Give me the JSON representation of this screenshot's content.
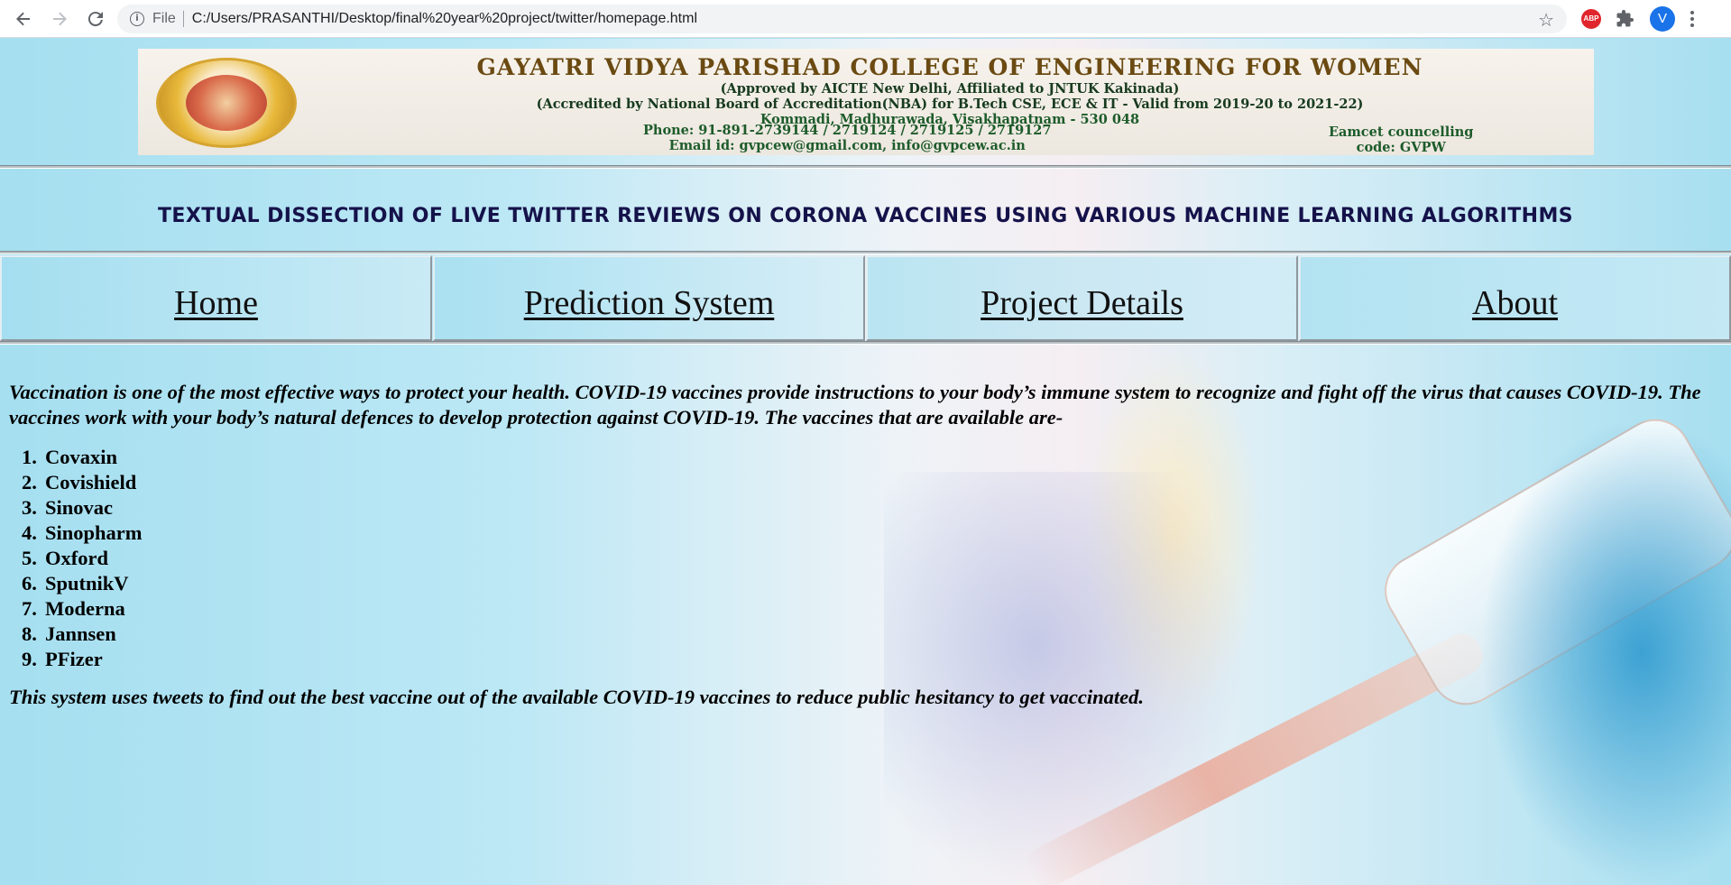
{
  "browser": {
    "file_label": "File",
    "url": "C:/Users/PRASANTHI/Desktop/final%20year%20project/twitter/homepage.html",
    "abp_label": "ABP",
    "profile_initial": "V"
  },
  "banner": {
    "title": "GAYATRI VIDYA PARISHAD COLLEGE OF ENGINEERING FOR WOMEN",
    "approval": "(Approved by AICTE New Delhi, Affiliated to JNTUK Kakinada)",
    "accreditation": "(Accredited by National Board of Accreditation(NBA) for B.Tech CSE, ECE & IT - Valid from 2019-20 to 2021-22)",
    "address": "Kommadi, Madhurawada, Visakhapatnam - 530 048",
    "phone": "Phone: 91-891-2739144 / 2719124 / 2719125 / 2719127",
    "email": "Email id: gvpcew@gmail.com, info@gvpcew.ac.in",
    "eamcet_line1": "Eamcet councelling",
    "eamcet_line2": "code: GVPW"
  },
  "project_title": "TEXTUAL DISSECTION OF LIVE TWITTER REVIEWS ON CORONA VACCINES USING VARIOUS MACHINE LEARNING ALGORITHMS",
  "nav": {
    "items": [
      {
        "label": "Home"
      },
      {
        "label": "Prediction System"
      },
      {
        "label": "Project Details"
      },
      {
        "label": "About"
      }
    ]
  },
  "content": {
    "intro": "Vaccination is one of the most effective ways to protect your health. COVID-19 vaccines provide instructions to your body’s immune system to recognize and fight off the virus that causes COVID-19. The vaccines work with your body’s natural defences to develop protection against COVID-19. The vaccines that are available are-",
    "vaccines": [
      {
        "num": "1.",
        "name": "Covaxin"
      },
      {
        "num": "2.",
        "name": "Covishield"
      },
      {
        "num": "3.",
        "name": "Sinovac"
      },
      {
        "num": "4.",
        "name": "Sinopharm"
      },
      {
        "num": "5.",
        "name": "Oxford"
      },
      {
        "num": "6.",
        "name": "SputnikV"
      },
      {
        "num": "7.",
        "name": "Moderna"
      },
      {
        "num": "8.",
        "name": "Jannsen"
      },
      {
        "num": "9.",
        "name": "PFizer"
      }
    ],
    "outro": "This system uses tweets to find out the best vaccine out of the available COVID-19 vaccines to reduce public hesitancy to get vaccinated."
  },
  "icons": {
    "back": "arrow-left-icon",
    "forward": "arrow-right-icon",
    "reload": "reload-icon",
    "info": "info-icon",
    "star": "star-icon",
    "extensions": "puzzle-icon",
    "menu": "more-vert-icon"
  },
  "colors": {
    "page_background": "#a9e1f1",
    "title_text": "#15124a",
    "banner_title": "#6b4a12",
    "banner_text": "#1d5b2a",
    "profile": "#1a73e8",
    "abp": "#e0262c"
  }
}
